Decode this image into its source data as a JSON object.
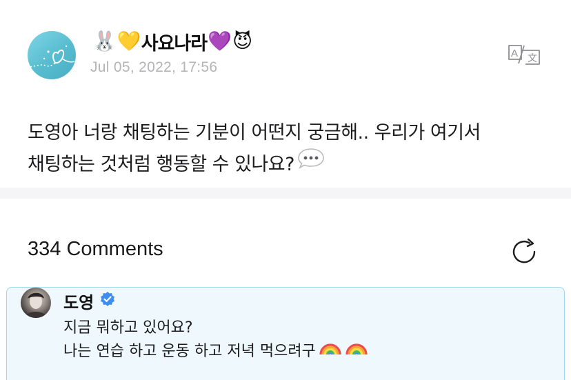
{
  "post": {
    "author": {
      "emoji_prefix": [
        "🐰",
        "💛"
      ],
      "name": "사요나라",
      "emoji_suffix": [
        "💜",
        "😈"
      ]
    },
    "date": "Jul 05, 2022, 17:56",
    "translate_icon": "translate-icon",
    "body_lines": [
      "도영아 너랑 채팅하는 기분이 어떤지 궁금해.. 우리가 여기서",
      "채팅하는 것처럼 행동할 수 있나요?"
    ],
    "body_trailing_icon": "speech-bubble-icon"
  },
  "comments": {
    "title": "334 Comments",
    "refresh_icon": "refresh-icon",
    "items": [
      {
        "author": "도영",
        "verified": true,
        "lines": [
          "지금 뭐하고 있어요?",
          "나는 연습 하고 운동 하고 저녁 먹으려구"
        ],
        "trailing_icons": [
          "rainbow-icon",
          "rainbow-icon"
        ]
      }
    ]
  },
  "colors": {
    "accent_blue": "#3d8ef0",
    "comment_bg": "#eef8fd",
    "comment_border": "#9ed6ee",
    "muted_text": "#b4b4b9"
  }
}
